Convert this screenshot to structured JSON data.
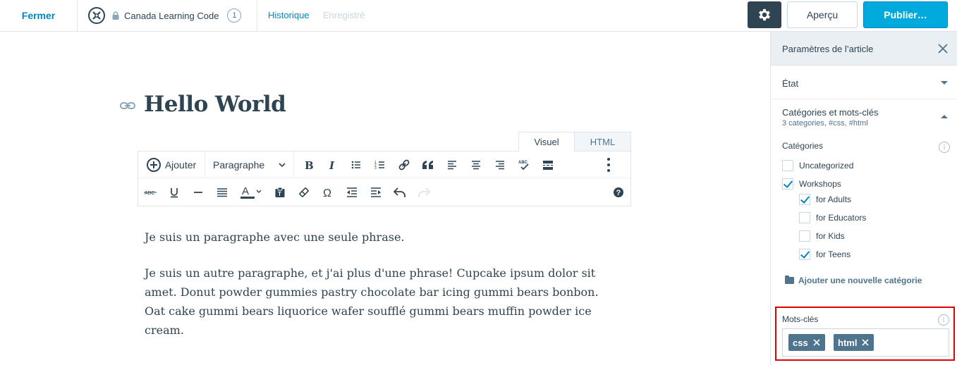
{
  "topbar": {
    "close_label": "Fermer",
    "site_name": "Canada Learning Code",
    "site_count": "1",
    "history_label": "Historique",
    "saved_label": "Enregistré",
    "preview_label": "Aperçu",
    "publish_label": "Publier…"
  },
  "editor": {
    "title": "Hello World",
    "tabs": {
      "visual": "Visuel",
      "html": "HTML"
    },
    "toolbar": {
      "add_label": "Ajouter",
      "format_value": "Paragraphe"
    },
    "paragraphs": [
      "Je suis un paragraphe avec une seule phrase.",
      "Je suis un autre paragraphe, et j'ai plus d'une phrase! Cupcake ipsum dolor sit amet. Donut powder gummies pastry chocolate bar icing gummi bears bonbon. Oat cake gummi bears liquorice wafer soufflé gummi bears muffin powder ice cream."
    ]
  },
  "sidebar": {
    "title": "Paramètres de l’article",
    "state_label": "État",
    "categories_section": {
      "label": "Catégories et mots-clés",
      "summary": "3 categories, #css, #html"
    },
    "categories_label": "Catégories",
    "categories": [
      {
        "label": "Uncategorized",
        "checked": false,
        "level": 0
      },
      {
        "label": "Workshops",
        "checked": true,
        "level": 0
      },
      {
        "label": "for Adults",
        "checked": true,
        "level": 1
      },
      {
        "label": "for Educators",
        "checked": false,
        "level": 1
      },
      {
        "label": "for Kids",
        "checked": false,
        "level": 1
      },
      {
        "label": "for Teens",
        "checked": true,
        "level": 1
      }
    ],
    "add_category_label": "Ajouter une nouvelle catégorie",
    "tags_label": "Mots-clés",
    "tags": [
      "css",
      "html"
    ]
  },
  "colors": {
    "accent": "#0087be",
    "publish": "#00aadc",
    "dark": "#2e4453",
    "tag_chip": "#4f748e",
    "highlight_border": "#e00000"
  }
}
